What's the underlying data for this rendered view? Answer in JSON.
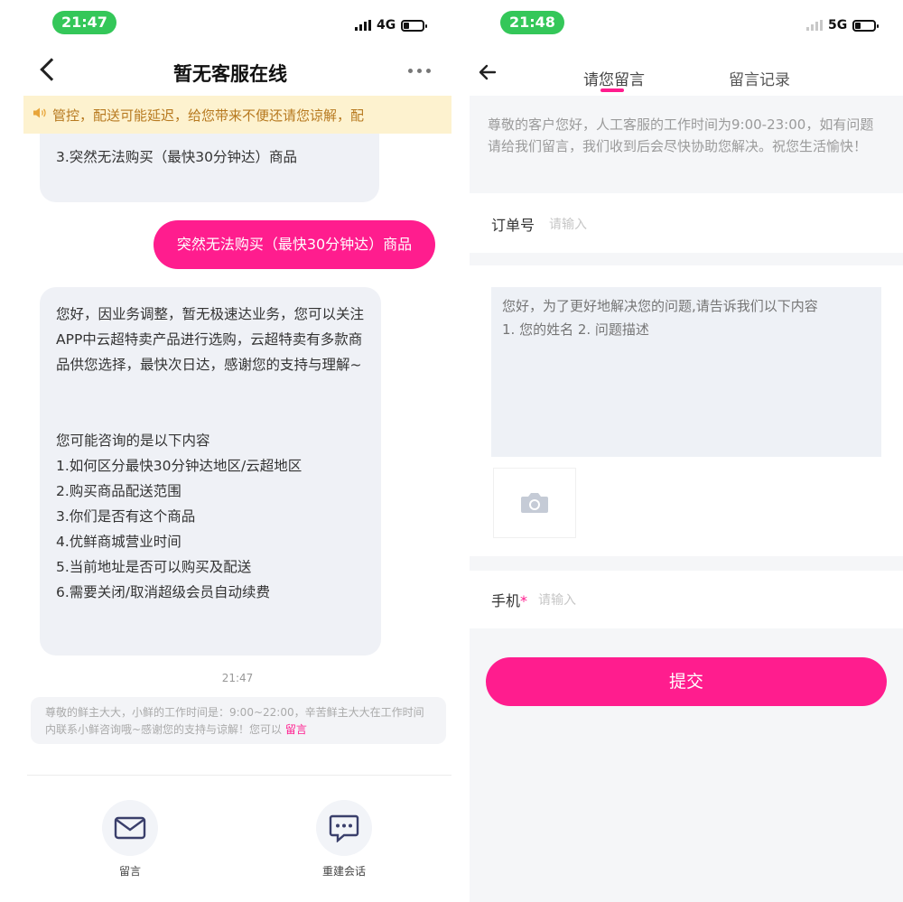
{
  "left": {
    "status": {
      "time": "21:47",
      "network": "4G"
    },
    "header": {
      "title": "暂无客服在线"
    },
    "notice": {
      "text": "管控，配送可能延迟，给您带来不便还请您谅解，配"
    },
    "messages": {
      "top_partial": "3.突然无法购买（最快30分钟达）商品",
      "user_reply": "突然无法购买（最快30分钟达）商品",
      "bot_reply": {
        "intro": "您好，因业务调整，暂无极速达业务，您可以关注APP中云超特卖产品进行选购，云超特卖有多款商品供您选择，最快次日达，感谢您的支持与理解~",
        "heading": "您可能咨询的是以下内容",
        "items": [
          "1.如何区分最快30分钟达地区/云超地区",
          "2.购买商品配送范围",
          "3.你们是否有这个商品",
          "4.优鲜商城营业时间",
          "5.当前地址是否可以购买及配送",
          "6.需要关闭/取消超级会员自动续费"
        ]
      },
      "timestamp": "21:47",
      "system": {
        "text": "尊敬的鲜主大大，小鲜的工作时间是：9:00~22:00，辛苦鲜主大大在工作时间内联系小鲜咨询哦~感谢您的支持与谅解！您可以",
        "link": "留言"
      }
    },
    "actions": [
      {
        "label": "留言",
        "icon": "mail-icon"
      },
      {
        "label": "重建会话",
        "icon": "chat-icon"
      }
    ]
  },
  "right": {
    "status": {
      "time": "21:48",
      "network": "5G"
    },
    "tabs": [
      {
        "label": "请您留言",
        "active": true
      },
      {
        "label": "留言记录",
        "active": false
      }
    ],
    "intro": "尊敬的客户您好，人工客服的工作时间为9:00-23:00，如有问题请给我们留言，我们收到后会尽快协助您解决。祝您生活愉快！",
    "order_field": {
      "label": "订单号",
      "placeholder": "请输入"
    },
    "message_field": {
      "placeholder": "您好，为了更好地解决您的问题,请告诉我们以下内容\n1. 您的姓名 2. 问题描述"
    },
    "phone_field": {
      "label": "手机",
      "required_mark": "*",
      "placeholder": "请输入"
    },
    "submit_label": "提交"
  },
  "colors": {
    "accent": "#ff1d8e",
    "status_green": "#34c759",
    "notice_bg": "#fdf2cf",
    "notice_text": "#b7791f"
  }
}
